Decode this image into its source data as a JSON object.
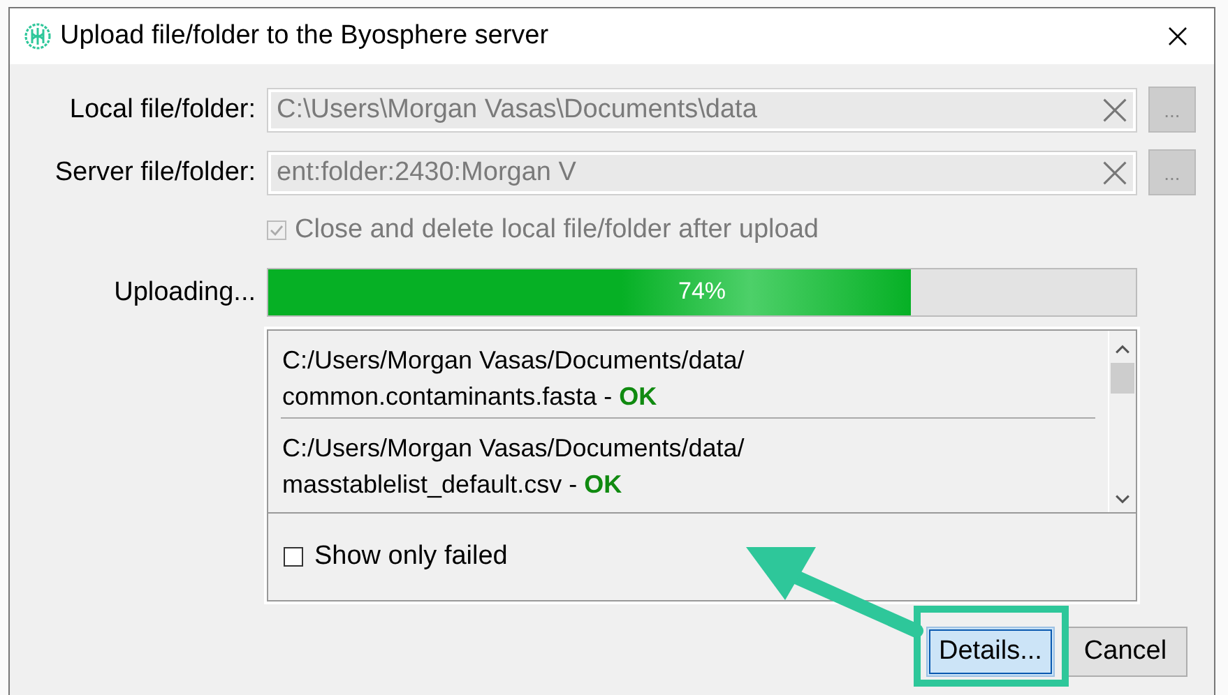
{
  "window": {
    "title": "Upload file/folder to the Byosphere server"
  },
  "fields": [
    {
      "label": "Local file/folder:",
      "value": "C:\\Users\\Morgan Vasas\\Documents\\data",
      "disabled": true
    },
    {
      "label": "Server file/folder:",
      "value": "ent:folder:2430:Morgan V",
      "disabled": true
    }
  ],
  "browse_buttons": [
    {
      "label": "...",
      "disabled": true
    },
    {
      "label": "...",
      "disabled": true
    }
  ],
  "delete_option": {
    "label": "Close and delete local file/folder after upload",
    "checked": true,
    "disabled": true
  },
  "progress": {
    "label": "Uploading...",
    "level": 0.74,
    "reading": "74%"
  },
  "files": [
    {
      "folder": "C:/Users/Morgan Vasas/Documents/data/",
      "file": "common.contaminants.fasta - **OK**"
    },
    {
      "folder": "C:/Users/Morgan Vasas/Documents/data/",
      "file": "masstablelist_default.csv - **OK**"
    }
  ],
  "failed_filter": {
    "label": "Show only failed",
    "checked": false
  },
  "buttons": [
    {
      "label": "Details...",
      "focused": true
    },
    {
      "label": "Cancel",
      "focused": false
    }
  ]
}
